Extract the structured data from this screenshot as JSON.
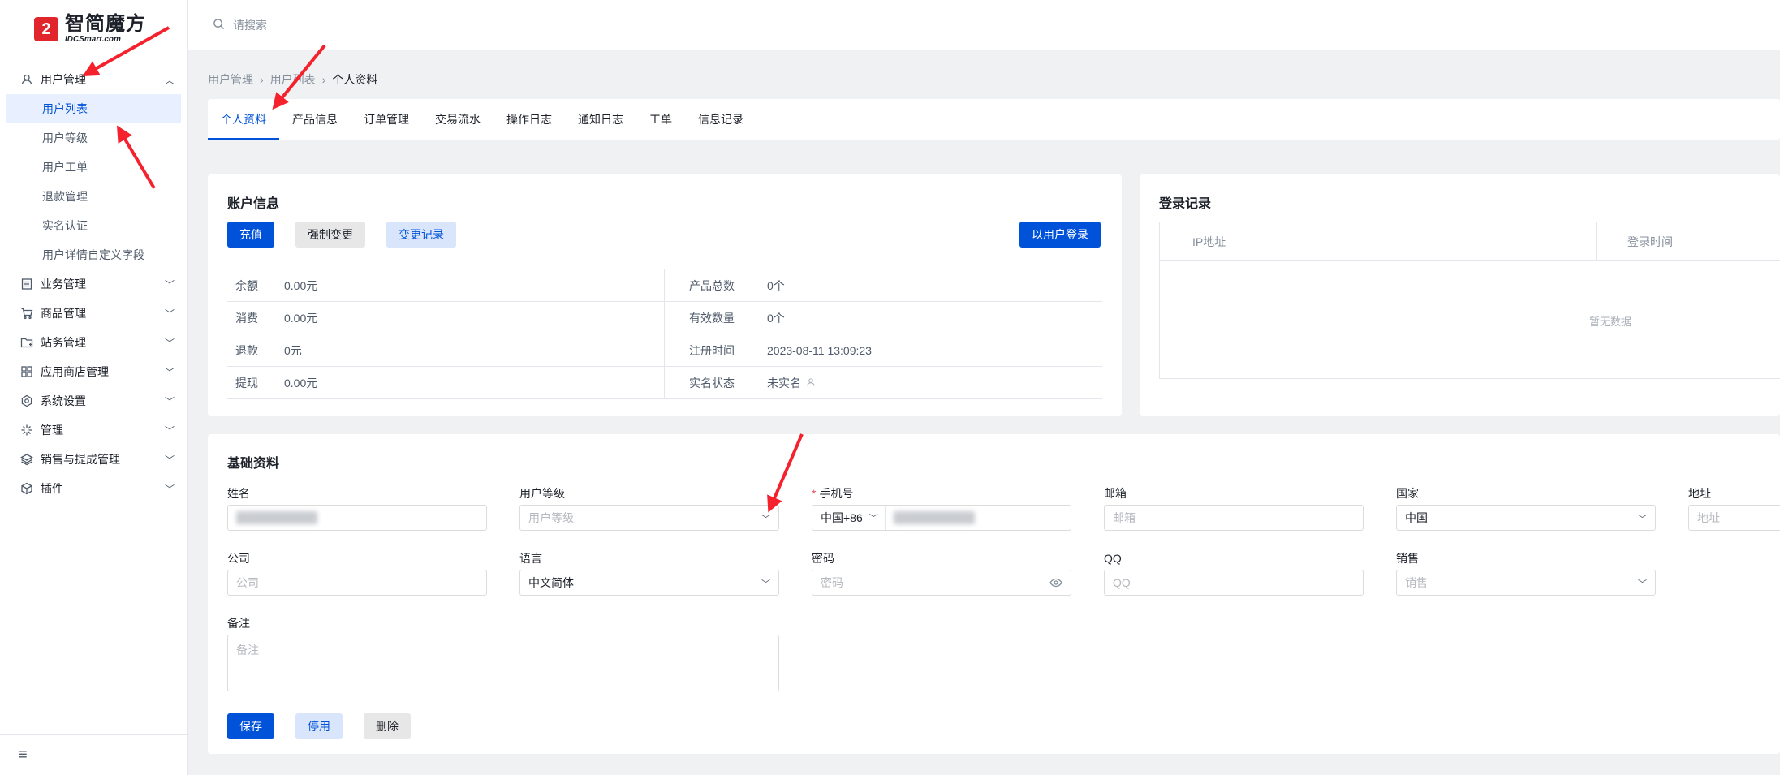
{
  "logo": {
    "mark": "2",
    "name": "智简魔方",
    "sub": "IDCSmart.com"
  },
  "search": {
    "placeholder": "请搜索"
  },
  "sidebar": {
    "groups": [
      {
        "label": "用户管理",
        "icon": "user-icon",
        "expanded": true,
        "items": [
          "用户列表",
          "用户等级",
          "用户工单",
          "退款管理",
          "实名认证",
          "用户详情自定义字段"
        ]
      },
      {
        "label": "业务管理",
        "icon": "document-icon"
      },
      {
        "label": "商品管理",
        "icon": "cart-icon"
      },
      {
        "label": "站务管理",
        "icon": "folder-icon"
      },
      {
        "label": "应用商店管理",
        "icon": "grid-icon"
      },
      {
        "label": "系统设置",
        "icon": "settings-icon"
      },
      {
        "label": "管理",
        "icon": "sparkle-icon"
      },
      {
        "label": "销售与提成管理",
        "icon": "layers-icon"
      },
      {
        "label": "插件",
        "icon": "cube-icon"
      }
    ],
    "active_item": "用户列表"
  },
  "breadcrumb": {
    "items": [
      "用户管理",
      "用户列表",
      "个人资料"
    ]
  },
  "tabs": [
    "个人资料",
    "产品信息",
    "订单管理",
    "交易流水",
    "操作日志",
    "通知日志",
    "工单",
    "信息记录"
  ],
  "active_tab": "个人资料",
  "account": {
    "title": "账户信息",
    "buttons": {
      "recharge": "充值",
      "force_change": "强制变更",
      "change_log": "变更记录",
      "login_as_user": "以用户登录"
    },
    "rows": [
      {
        "k1": "余额",
        "v1": "0.00元",
        "k2": "产品总数",
        "v2": "0个"
      },
      {
        "k1": "消费",
        "v1": "0.00元",
        "k2": "有效数量",
        "v2": "0个"
      },
      {
        "k1": "退款",
        "v1": "0元",
        "k2": "注册时间",
        "v2": "2023-08-11 13:09:23"
      },
      {
        "k1": "提现",
        "v1": "0.00元",
        "k2": "实名状态",
        "v2": "未实名"
      }
    ]
  },
  "login_records": {
    "title": "登录记录",
    "col_ip": "IP地址",
    "col_time": "登录时间",
    "empty": "暂无数据"
  },
  "basic": {
    "title": "基础资料",
    "name": {
      "label": "姓名"
    },
    "level": {
      "label": "用户等级",
      "placeholder": "用户等级"
    },
    "phone": {
      "label": "手机号",
      "prefix": "中国+86"
    },
    "email": {
      "label": "邮箱",
      "placeholder": "邮箱"
    },
    "country": {
      "label": "国家",
      "value": "中国"
    },
    "address": {
      "label": "地址",
      "placeholder": "地址"
    },
    "company": {
      "label": "公司",
      "placeholder": "公司"
    },
    "language": {
      "label": "语言",
      "value": "中文简体"
    },
    "password": {
      "label": "密码",
      "placeholder": "密码"
    },
    "qq": {
      "label": "QQ",
      "placeholder": "QQ"
    },
    "sales": {
      "label": "销售",
      "placeholder": "销售"
    },
    "note": {
      "label": "备注",
      "placeholder": "备注"
    },
    "buttons": {
      "save": "保存",
      "disable": "停用",
      "delete": "删除"
    }
  },
  "colors": {
    "primary": "#0052d9",
    "annotation": "#f5222d",
    "logo": "#e0262c"
  }
}
